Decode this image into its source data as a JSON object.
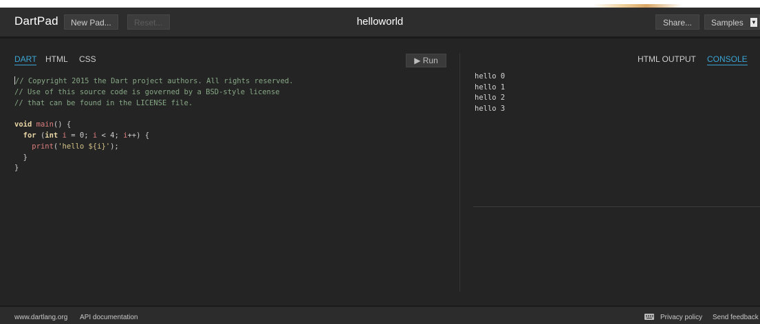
{
  "header": {
    "logo": "DartPad",
    "new_pad_label": "New Pad...",
    "reset_label": "Reset...",
    "title": "helloworld",
    "share_label": "Share...",
    "samples_label": "Samples"
  },
  "editor_tabs": [
    {
      "label": "DART",
      "active": true
    },
    {
      "label": "HTML",
      "active": false
    },
    {
      "label": "CSS",
      "active": false
    }
  ],
  "run_label": "▶ Run",
  "code_lines": [
    "// Copyright 2015 the Dart project authors. All rights reserved.",
    "// Use of this source code is governed by a BSD-style license",
    "// that can be found in the LICENSE file.",
    "",
    "void main() {",
    "  for (int i = 0; i < 4; i++) {",
    "    print('hello ${i}');",
    "  }",
    "}"
  ],
  "output_tabs": [
    {
      "label": "HTML OUTPUT",
      "active": false
    },
    {
      "label": "CONSOLE",
      "active": true
    }
  ],
  "console_lines": [
    "hello 0",
    "hello 1",
    "hello 2",
    "hello 3"
  ],
  "footer": {
    "left_links": [
      "www.dartlang.org",
      "API documentation"
    ],
    "right_links": [
      "Privacy policy",
      "Send feedback"
    ],
    "keyboard_icon": "keyboard-icon"
  },
  "colors": {
    "accent": "#3aa6d6",
    "background": "#242424",
    "header": "#2d2d2d"
  }
}
